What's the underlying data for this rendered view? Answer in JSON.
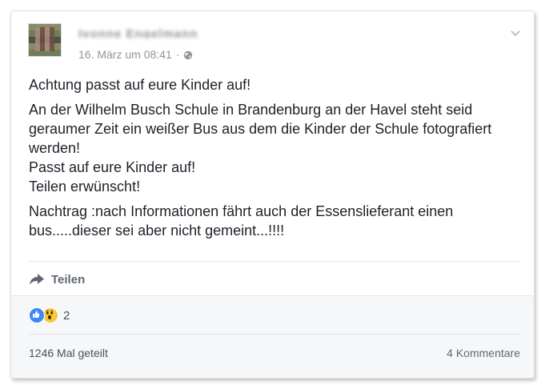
{
  "post": {
    "author_name": "Ivonne Engelmann",
    "timestamp": "16. März um 08:41",
    "separator": "·",
    "privacy_icon": "globe-icon",
    "options_icon": "chevron-down-icon",
    "paragraphs": [
      "Achtung passt auf eure Kinder auf!",
      "An der Wilhelm Busch Schule in Brandenburg an der Havel steht seid geraumer Zeit ein weißer Bus aus dem die Kinder der Schule fotografiert werden!",
      "Passt auf eure Kinder auf!",
      "Teilen erwünscht!",
      "Nachtrag :nach Informationen fährt auch der Essenslieferant einen bus.....dieser sei aber nicht gemeint...!!!!"
    ],
    "share_label": "Teilen"
  },
  "footer": {
    "reaction_icons": [
      "like-icon",
      "wow-icon"
    ],
    "reaction_count": "2",
    "shares_label": "1246 Mal geteilt",
    "comments_label": "4 Kommentare"
  },
  "colors": {
    "text": "#1d2129",
    "muted": "#90949c",
    "like_blue": "#3b89f5",
    "wow_yellow": "#f7c93a",
    "footer_bg": "#f6f7f9"
  }
}
